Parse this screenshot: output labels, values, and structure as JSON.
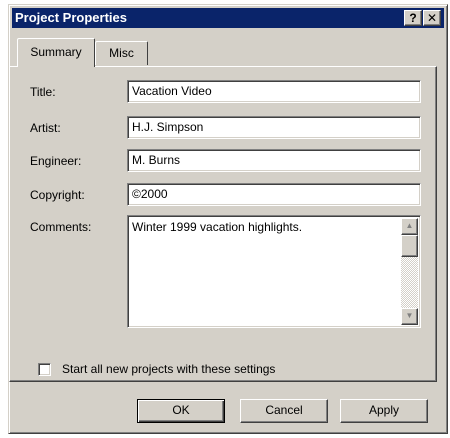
{
  "window": {
    "title": "Project Properties",
    "help_button": "?",
    "close_button": "✕"
  },
  "tabs": [
    {
      "label": "Summary",
      "active": true
    },
    {
      "label": "Misc",
      "active": false
    }
  ],
  "form": {
    "title_label": "Title:",
    "title_value": "Vacation Video",
    "artist_label": "Artist:",
    "artist_value": "H.J. Simpson",
    "engineer_label": "Engineer:",
    "engineer_value": "M. Burns",
    "copyright_label": "Copyright:",
    "copyright_value": "©2000",
    "comments_label": "Comments:",
    "comments_value": "Winter 1999 vacation highlights."
  },
  "checkbox": {
    "label": "Start all new projects with these settings",
    "checked": false
  },
  "buttons": {
    "ok": "OK",
    "cancel": "Cancel",
    "apply": "Apply"
  },
  "colors": {
    "titlebar": "#0a246a",
    "face": "#d4d0c8"
  }
}
